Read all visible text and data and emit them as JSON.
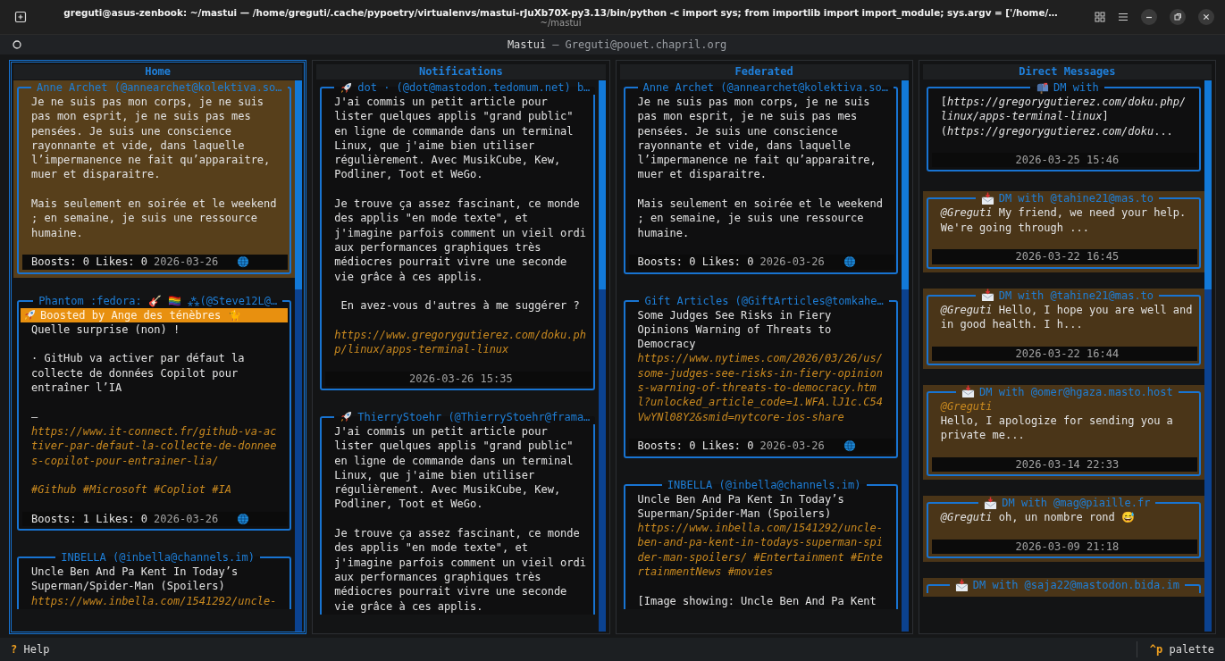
{
  "window": {
    "title": "greguti@asus-zenbook: ~/mastui — /home/greguti/.cache/pypoetry/virtualenvs/mastui-rJuXb70X-py3.13/bin/python -c import sys; from importlib import import_module; sys.argv = ['/home/…",
    "subtitle": "~/mastui"
  },
  "app": {
    "title": "Mastui",
    "separator": "—",
    "account": "Greguti@pouet.chapril.org"
  },
  "columns": [
    {
      "title": "Home",
      "selected": true,
      "posts": [
        {
          "author": "Anne Archet (@annearchet@kolektiva.so…",
          "highlighted": true,
          "cut": false,
          "body": [
            {
              "kind": "text",
              "text": "Je ne suis pas mon corps, je ne suis pas mon esprit, je ne suis pas mes pensées. Je suis une conscience rayonnante et vide, dans laquelle l’impermanence ne fait qu’apparaitre, muer et disparaitre."
            },
            {
              "kind": "blank"
            },
            {
              "kind": "text",
              "text": "Mais seulement en soirée et le weekend ; en semaine, je suis une ressource humaine."
            }
          ],
          "stats": "Boosts: 0 Likes: 0",
          "date": "2026-03-26",
          "public": true
        },
        {
          "author": "Phantom :fedora:  🎸 🏳️‍🌈 ⁂(@Steve12L@…",
          "highlighted": false,
          "cut": false,
          "boosted_by": "Boosted by Ange des ténèbres 🐈",
          "body": [
            {
              "kind": "text",
              "text": "Quelle surprise (non) !"
            },
            {
              "kind": "blank"
            },
            {
              "kind": "text",
              "text": "· GitHub va activer par défaut la collecte de données Copilot pour entraîner l’IA"
            },
            {
              "kind": "blank"
            },
            {
              "kind": "text",
              "text": "–"
            },
            {
              "kind": "link",
              "text": "https://www.it-connect.fr/github-va-activer-par-defaut-la-collecte-de-donnees-copilot-pour-entrainer-lia/"
            },
            {
              "kind": "blank"
            },
            {
              "kind": "link",
              "text": "#Github #Microsoft #Copliot #IA"
            }
          ],
          "stats": "Boosts: 1 Likes: 0",
          "date": "2026-03-26",
          "public": true
        },
        {
          "author": "INBELLA (@inbella@channels.im)",
          "highlighted": false,
          "cut": true,
          "body": [
            {
              "kind": "text",
              "text": "Uncle Ben And Pa Kent In Today’s Superman/Spider-Man (Spoilers)"
            },
            {
              "kind": "link",
              "text": "https://www.inbella.com/1541292/uncle-"
            }
          ]
        }
      ]
    },
    {
      "title": "Notifications",
      "selected": false,
      "posts": [
        {
          "kind": "reblog",
          "author": "dot · (@dot@mastodon.tedomum.net) b…",
          "highlighted": false,
          "cut": false,
          "body": [
            {
              "kind": "text",
              "text": "J'ai commis un petit article pour lister quelques applis \"grand public\" en ligne de commande dans un terminal Linux, que j'aime bien utiliser régulièrement. Avec MusikCube, Kew, Podliner, Toot et WeGo."
            },
            {
              "kind": "blank"
            },
            {
              "kind": "text",
              "text": "Je trouve ça assez fascinant, ce monde des applis \"en mode texte\", et j'imagine parfois comment un vieil ordi aux performances graphiques très médiocres pourrait vivre une seconde vie grâce à ces applis."
            },
            {
              "kind": "blank"
            },
            {
              "kind": "text",
              "text": " En avez-vous d'autres à me suggérer ?"
            },
            {
              "kind": "blank"
            },
            {
              "kind": "link",
              "text": "https://www.gregorygutierez.com/doku.php/linux/apps-terminal-linux"
            }
          ],
          "date": "2026-03-26 15:35"
        },
        {
          "kind": "reblog",
          "author": "ThierryStoehr (@ThierryStoehr@frama…",
          "highlighted": false,
          "cut": true,
          "body": [
            {
              "kind": "text",
              "text": "J'ai commis un petit article pour lister quelques applis \"grand public\" en ligne de commande dans un terminal Linux, que j'aime bien utiliser régulièrement. Avec MusikCube, Kew, Podliner, Toot et WeGo."
            },
            {
              "kind": "blank"
            },
            {
              "kind": "text",
              "text": "Je trouve ça assez fascinant, ce monde des applis \"en mode texte\", et j'imagine parfois comment un vieil ordi aux performances graphiques très médiocres pourrait vivre une seconde vie grâce à ces applis."
            }
          ]
        }
      ]
    },
    {
      "title": "Federated",
      "selected": false,
      "posts": [
        {
          "author": "Anne Archet (@annearchet@kolektiva.so…",
          "highlighted": false,
          "cut": false,
          "body": [
            {
              "kind": "text",
              "text": "Je ne suis pas mon corps, je ne suis pas mon esprit, je ne suis pas mes pensées. Je suis une conscience rayonnante et vide, dans laquelle l’impermanence ne fait qu’apparaitre, muer et disparaitre."
            },
            {
              "kind": "blank"
            },
            {
              "kind": "text",
              "text": "Mais seulement en soirée et le weekend ; en semaine, je suis une ressource humaine."
            }
          ],
          "stats": "Boosts: 0 Likes: 0",
          "date": "2026-03-26",
          "public": true
        },
        {
          "author": "Gift Articles (@GiftArticles@tomkahe…",
          "highlighted": false,
          "cut": false,
          "body": [
            {
              "kind": "text",
              "text": "Some Judges See Risks in Fiery Opinions Warning of Threats to Democracy"
            },
            {
              "kind": "link",
              "text": "https://www.nytimes.com/2026/03/26/us/some-judges-see-risks-in-fiery-opinions-warning-of-threats-to-democracy.html?unlocked_article_code=1.WFA.lJ1c.C54VwYNl08Y2&smid=nytcore-ios-share"
            }
          ],
          "stats": "Boosts: 0 Likes: 0",
          "date": "2026-03-26",
          "public": true
        },
        {
          "author": "INBELLA (@inbella@channels.im)",
          "highlighted": false,
          "cut": true,
          "body": [
            {
              "kind": "text",
              "text": "Uncle Ben And Pa Kent In Today’s Superman/Spider-Man (Spoilers)"
            },
            {
              "kind": "link",
              "text": "https://www.inbella.com/1541292/uncle-ben-and-pa-kent-in-todays-superman-spider-man-spoilers/ #Entertainment #EntertainmentNews #movies"
            },
            {
              "kind": "blank"
            },
            {
              "kind": "text",
              "text": "[Image showing: Uncle Ben And Pa Kent"
            }
          ]
        }
      ]
    },
    {
      "title": "Direct Messages",
      "selected": false,
      "posts": [
        {
          "kind": "conversation",
          "author": "DM with",
          "highlighted": false,
          "cut": false,
          "body": [
            {
              "kind": "text",
              "text": "[*https://gregorygutierez.com/doku.php/linux/apps-terminal-linux*](*https://gregorygutierez.com/doku*..."
            }
          ],
          "date": "2026-03-25 15:46"
        },
        {
          "kind": "direct",
          "author": "DM with @tahine21@mas.to",
          "highlighted": true,
          "cut": false,
          "body": [
            {
              "kind": "text",
              "text": "*@Greguti* My friend, we need your help. We're going through ..."
            }
          ],
          "date": "2026-03-22 16:45"
        },
        {
          "kind": "direct",
          "author": "DM with @tahine21@mas.to",
          "highlighted": true,
          "cut": false,
          "body": [
            {
              "kind": "text",
              "text": "*@Greguti* Hello, I hope you are well and in good health. I h..."
            }
          ],
          "date": "2026-03-22 16:44"
        },
        {
          "kind": "direct",
          "author": "DM with @omer@hgaza.masto.host",
          "highlighted": true,
          "cut": false,
          "body": [
            {
              "kind": "link",
              "text": "@Greguti"
            },
            {
              "kind": "text",
              "text": "Hello, I apologize for sending you a private me..."
            }
          ],
          "date": "2026-03-14 22:33"
        },
        {
          "kind": "direct",
          "author": "DM with @mag@piaille.fr",
          "highlighted": true,
          "cut": false,
          "body": [
            {
              "kind": "text",
              "text": "*@Greguti* oh, un nombre rond 😅"
            }
          ],
          "date": "2026-03-09 21:18"
        },
        {
          "kind": "direct",
          "author": "DM with @saja22@mastodon.bida.im",
          "highlighted": true,
          "cut": true
        }
      ]
    }
  ],
  "status_bar": {
    "left": [
      {
        "key": "?",
        "label": "Help"
      }
    ],
    "right": [
      {
        "key": "^p",
        "label": "palette"
      }
    ]
  }
}
